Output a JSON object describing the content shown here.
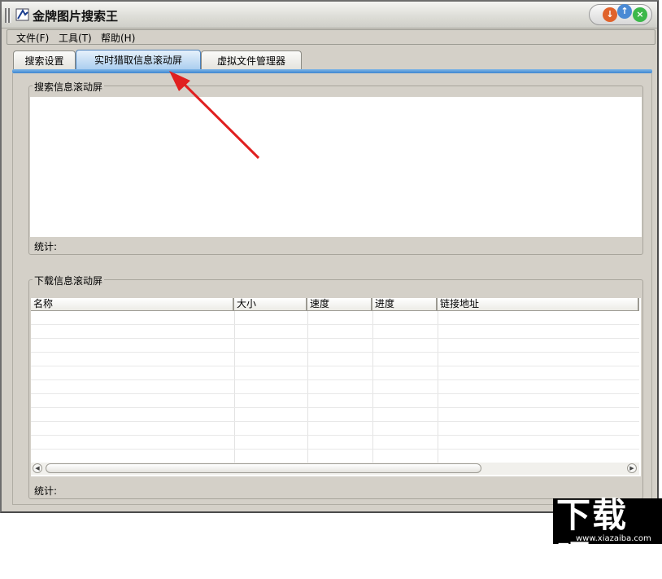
{
  "window": {
    "title": "金牌图片搜索王"
  },
  "menu": [
    "文件(F)",
    "工具(T)",
    "帮助(H)"
  ],
  "tabs": [
    {
      "label": "搜索设置"
    },
    {
      "label": "实时猎取信息滚动屏",
      "active": true
    },
    {
      "label": "虚拟文件管理器"
    }
  ],
  "search_panel": {
    "title": "搜索信息滚动屏",
    "stat_label": "统计:"
  },
  "download_panel": {
    "title": "下载信息滚动屏",
    "columns": [
      "名称",
      "大小",
      "速度",
      "进度",
      "链接地址"
    ],
    "rows": [],
    "stat_label": "统计:"
  },
  "colors": {
    "tab_accent": "#3d86d0",
    "annotation_arrow": "#e02020",
    "close": "#3cb84a",
    "minimize": "#e0632c",
    "maximize": "#4a8ad4"
  },
  "icons": {
    "minimize": "minimize-icon",
    "maximize": "maximize-icon",
    "close": "close-icon"
  },
  "watermark": {
    "text": "下载吧",
    "url": "www.xiazaiba.com"
  }
}
